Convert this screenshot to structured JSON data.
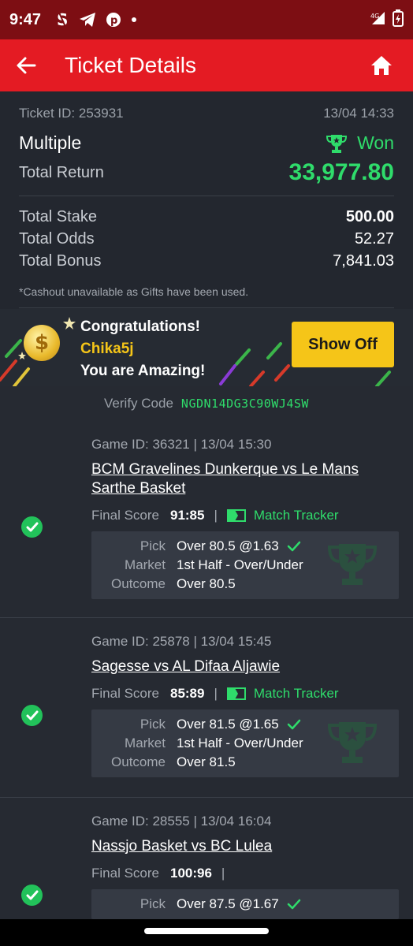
{
  "status_bar": {
    "time": "9:47",
    "network": "4G"
  },
  "app_bar": {
    "title": "Ticket Details"
  },
  "ticket": {
    "id_label": "Ticket ID: 253931",
    "datetime": "13/04 14:33",
    "type": "Multiple",
    "status": "Won",
    "total_return_label": "Total Return",
    "total_return": "33,977.80",
    "rows": [
      {
        "label": "Total Stake",
        "value": "500.00"
      },
      {
        "label": "Total Odds",
        "value": "52.27"
      },
      {
        "label": "Total Bonus",
        "value": "7,841.03"
      }
    ],
    "cashout_note": "*Cashout unavailable as Gifts have been used."
  },
  "banner": {
    "line1": "Congratulations!",
    "username": "Chika5j",
    "line3": "You are Amazing!",
    "button": "Show Off"
  },
  "verify": {
    "label": "Verify Code",
    "code": "NGDN14DG3C90WJ4SW"
  },
  "games": [
    {
      "header": "Game ID: 36321 | 13/04 15:30",
      "name": "BCM Gravelines Dunkerque vs Le Mans Sarthe Basket",
      "score_label": "Final Score",
      "score": "91:85",
      "tracker": "Match Tracker",
      "pick_label": "Pick",
      "pick": "Over 80.5 @1.63",
      "market_label": "Market",
      "market": "1st Half - Over/Under",
      "outcome_label": "Outcome",
      "outcome": "Over 80.5"
    },
    {
      "header": "Game ID: 25878 | 13/04 15:45",
      "name": "Sagesse vs AL Difaa Aljawie",
      "score_label": "Final Score",
      "score": "85:89",
      "tracker": "Match Tracker",
      "pick_label": "Pick",
      "pick": "Over 81.5 @1.65",
      "market_label": "Market",
      "market": "1st Half - Over/Under",
      "outcome_label": "Outcome",
      "outcome": "Over 81.5"
    },
    {
      "header": "Game ID: 28555 | 13/04 16:04",
      "name": "Nassjo Basket vs BC Lulea",
      "score_label": "Final Score",
      "score": "100:96",
      "pick_label": "Pick",
      "pick": "Over 87.5 @1.67"
    }
  ],
  "colors": {
    "red": "#e41b23",
    "dark_red": "#7d0e13",
    "green": "#2fdc6b",
    "yellow": "#f5c518"
  }
}
